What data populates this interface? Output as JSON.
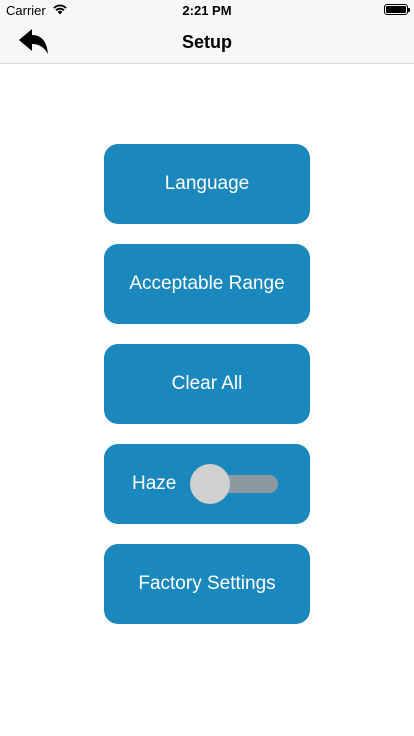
{
  "status_bar": {
    "carrier": "Carrier",
    "time": "2:21 PM"
  },
  "nav": {
    "title": "Setup",
    "back_icon": "back-arrow-icon"
  },
  "menu": {
    "language": "Language",
    "acceptable_range": "Acceptable Range",
    "clear_all": "Clear All",
    "haze_label": "Haze",
    "haze_enabled": false,
    "factory_settings": "Factory Settings"
  },
  "colors": {
    "button_bg": "#1a87bd",
    "button_text": "#ffffff",
    "toggle_track": "#8c9aa0",
    "toggle_knob": "#d0d0d0"
  }
}
